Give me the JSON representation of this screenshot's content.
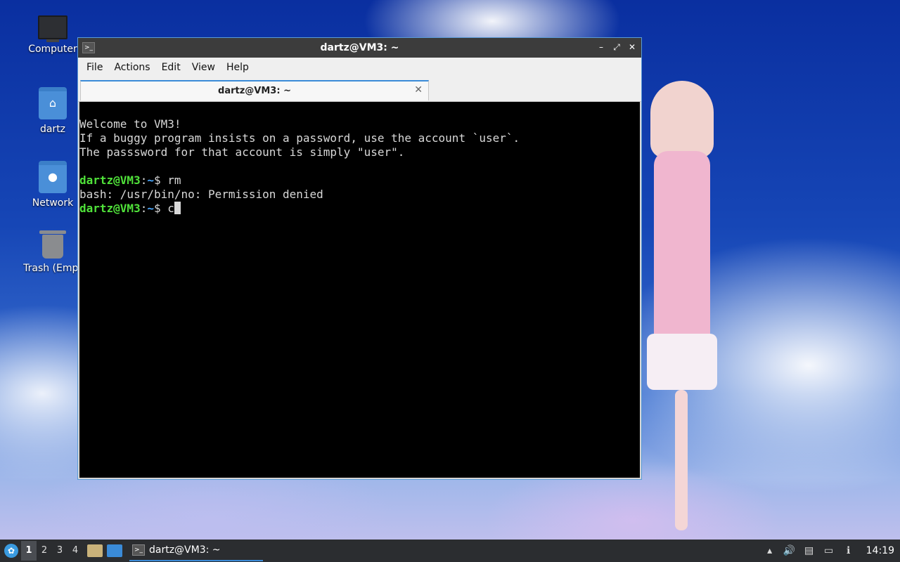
{
  "desktop": {
    "icons": [
      {
        "label": "Computer"
      },
      {
        "label": "dartz"
      },
      {
        "label": "Network"
      },
      {
        "label": "Trash (Empt"
      }
    ]
  },
  "window": {
    "title": "dartz@VM3: ~",
    "controls": {
      "minimize": "–",
      "maximize": "⤢",
      "close": "✕"
    },
    "menu": [
      "File",
      "Actions",
      "Edit",
      "View",
      "Help"
    ],
    "tab": {
      "label": "dartz@VM3: ~",
      "close": "✕"
    },
    "terminal": {
      "lines": [
        "Welcome to VM3!",
        "If a buggy program insists on a password, use the account `user`.",
        "The passsword for that account is simply \"user\"."
      ],
      "prompt_user": "dartz@VM3",
      "prompt_sep": ":",
      "prompt_path": "~",
      "prompt_end": "$ ",
      "cmd1": "rm",
      "output1": "bash: /usr/bin/no: Permission denied",
      "cmd2": "c"
    }
  },
  "taskbar": {
    "workspaces": [
      "1",
      "2",
      "3",
      "4"
    ],
    "active_workspace": "1",
    "task_label": "dartz@VM3: ~",
    "clock": "14:19"
  }
}
